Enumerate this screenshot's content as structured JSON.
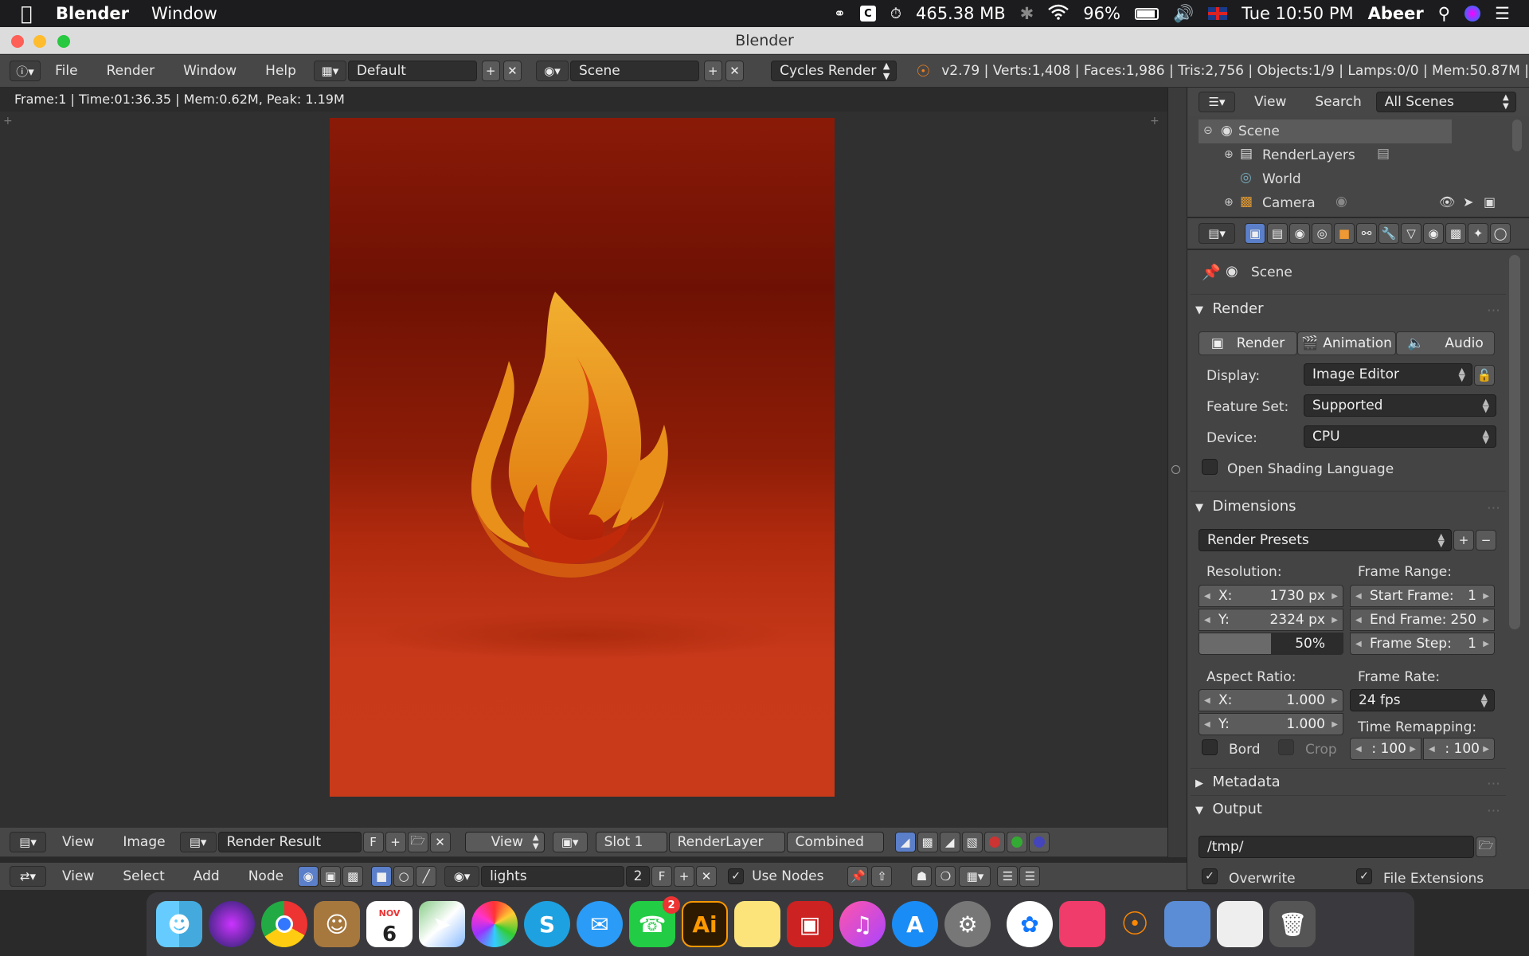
{
  "menubar": {
    "app_name": "Blender",
    "items": [
      "Window"
    ],
    "memory": "465.38 MB",
    "battery": "96%",
    "datetime": "Tue 10:50 PM",
    "user": "Abeer"
  },
  "window": {
    "title": "Blender"
  },
  "info_header": {
    "menus": [
      "File",
      "Render",
      "Window",
      "Help"
    ],
    "layout": "Default",
    "scene": "Scene",
    "engine": "Cycles Render",
    "stats": "v2.79 | Verts:1,408 | Faces:1,986 | Tris:2,756 | Objects:1/9 | Lamps:0/0 | Mem:50.87M |"
  },
  "image_editor": {
    "render_info": "Frame:1 | Time:01:36.35 | Mem:0.62M, Peak: 1.19M",
    "footer": {
      "view": "View",
      "image": "Image",
      "image_name": "Render Result",
      "fake_user": "F",
      "view2": "View",
      "slot": "Slot 1",
      "layer": "RenderLayer",
      "pass": "Combined"
    }
  },
  "node_header": {
    "view": "View",
    "select": "Select",
    "add": "Add",
    "node": "Node",
    "material": "lights",
    "users": "2",
    "fake_user": "F",
    "use_nodes": "Use Nodes"
  },
  "outliner": {
    "view": "View",
    "search": "Search",
    "filter": "All Scenes",
    "items": [
      "Scene",
      "RenderLayers",
      "World",
      "Camera"
    ]
  },
  "properties": {
    "context": "Scene",
    "render": {
      "header": "Render",
      "buttons": [
        "Render",
        "Animation",
        "Audio"
      ],
      "display_label": "Display:",
      "display": "Image Editor",
      "feature_label": "Feature Set:",
      "feature": "Supported",
      "device_label": "Device:",
      "device": "CPU",
      "osl": "Open Shading Language"
    },
    "dimensions": {
      "header": "Dimensions",
      "presets": "Render Presets",
      "resolution_label": "Resolution:",
      "res_x_label": "X:",
      "res_x": "1730 px",
      "res_y_label": "Y:",
      "res_y": "2324 px",
      "res_pct": "50%",
      "res_pct_value": 0.5,
      "frame_range_label": "Frame Range:",
      "start_label": "Start Frame:",
      "start": "1",
      "end_label": "End Frame:",
      "end": "250",
      "step_label": "Frame Step:",
      "step": "1",
      "aspect_label": "Aspect Ratio:",
      "asp_x_label": "X:",
      "asp_x": "1.000",
      "asp_y_label": "Y:",
      "asp_y": "1.000",
      "frame_rate_label": "Frame Rate:",
      "fps": "24 fps",
      "bord": "Bord",
      "crop": "Crop",
      "remap_label": "Time Remapping:",
      "remap_old": ": 100",
      "remap_new": ": 100"
    },
    "metadata": {
      "header": "Metadata"
    },
    "output": {
      "header": "Output",
      "path": "/tmp/",
      "overwrite": "Overwrite",
      "file_ext": "File Extensions"
    }
  },
  "dock": {
    "calendar_month": "NOV",
    "calendar_day": "6",
    "facetime_badge": "2",
    "illustrator": "Ai"
  },
  "colors": {
    "render_bg_top": "#8a1a08",
    "render_bg_bottom": "#c8391a",
    "flame_yellow": "#f0a020",
    "flame_red": "#c82808"
  }
}
